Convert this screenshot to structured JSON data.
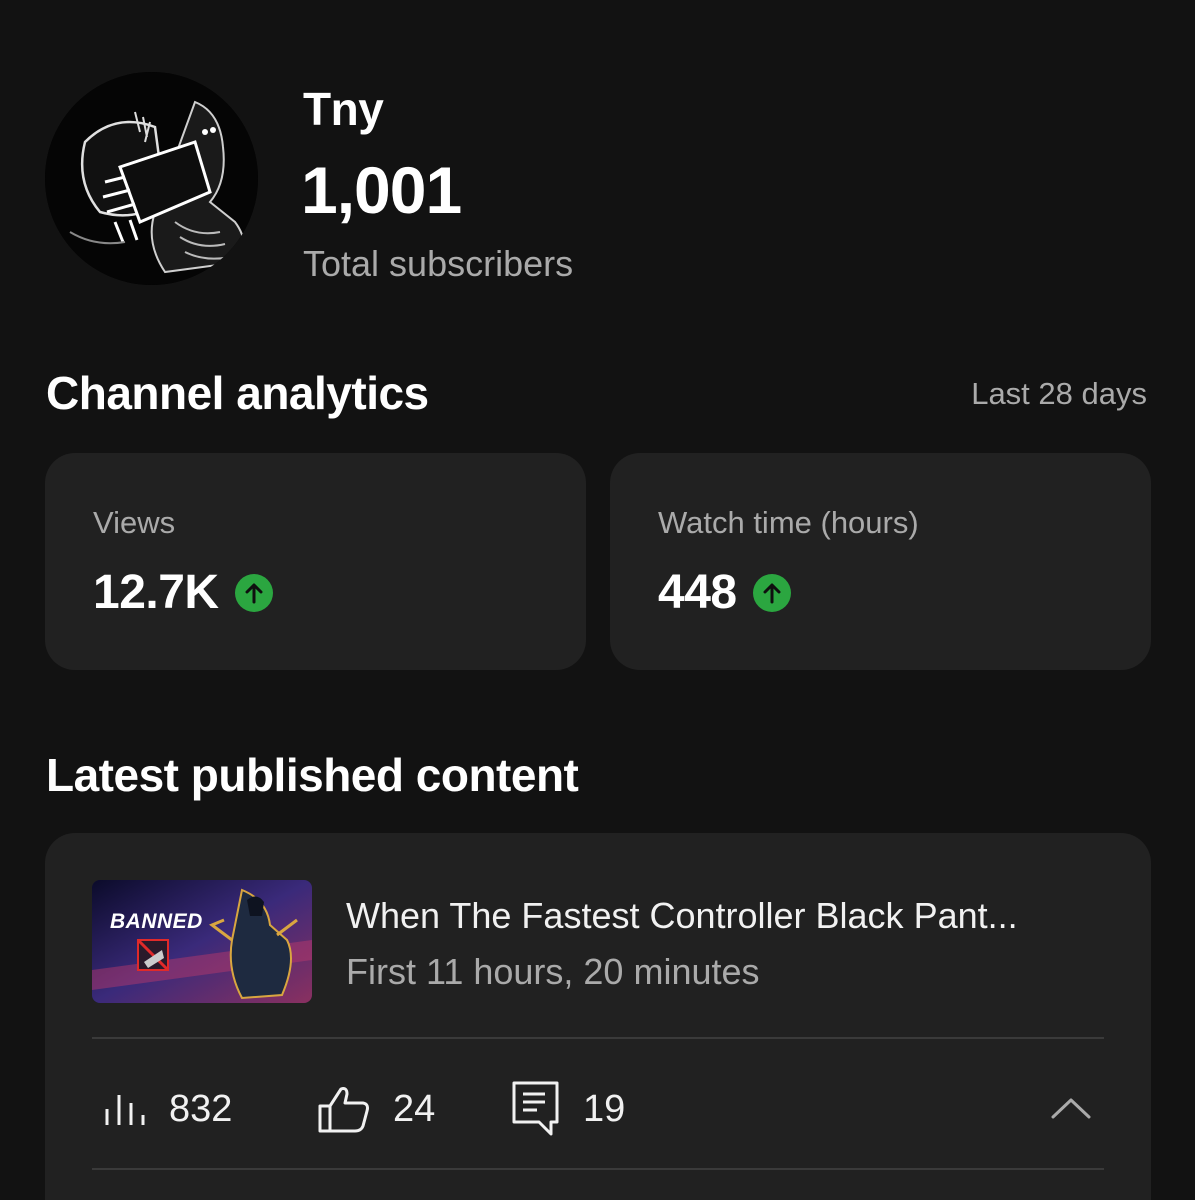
{
  "channel": {
    "name": "Tny",
    "subscriber_count": "1,001",
    "subscriber_label": "Total subscribers",
    "avatar_icon": "channel-avatar-icon"
  },
  "analytics": {
    "title": "Channel analytics",
    "period": "Last 28 days",
    "metrics": [
      {
        "label": "Views",
        "value": "12.7K",
        "trend": "up",
        "trend_color": "#2ba640"
      },
      {
        "label": "Watch time (hours)",
        "value": "448",
        "trend": "up",
        "trend_color": "#2ba640"
      }
    ]
  },
  "latest": {
    "title": "Latest published content",
    "video": {
      "title": "When The Fastest Controller Black Pant...",
      "subtitle": "First 11 hours, 20 minutes",
      "thumbnail_text": "BANNED",
      "stats": {
        "views": "832",
        "likes": "24",
        "comments": "19"
      }
    }
  },
  "colors": {
    "background": "#121212",
    "card": "#212121",
    "text_primary": "#f1f1f1",
    "text_secondary": "#aaaaaa",
    "trend_up": "#2ba640"
  }
}
